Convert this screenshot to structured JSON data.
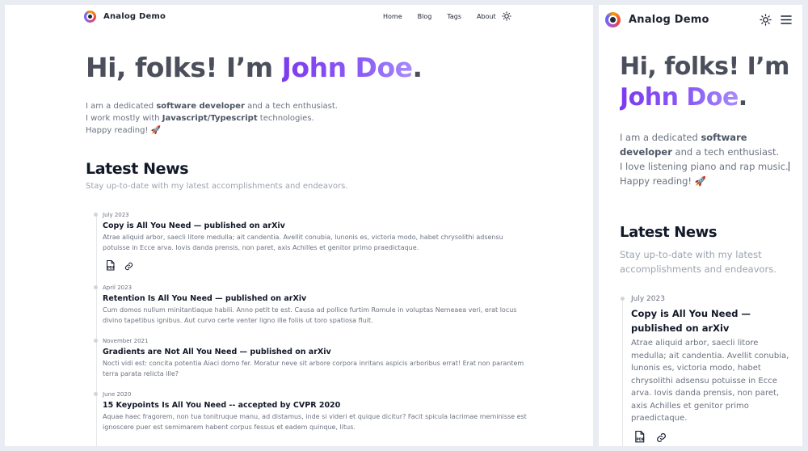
{
  "brand": {
    "name": "Analog Demo"
  },
  "nav": {
    "items": [
      {
        "label": "Home"
      },
      {
        "label": "Blog"
      },
      {
        "label": "Tags"
      },
      {
        "label": "About"
      }
    ]
  },
  "hero": {
    "greeting": "Hi, folks! I’m",
    "name": "John Doe",
    "period": "."
  },
  "intro_desktop": {
    "l1a": "I am a dedicated ",
    "l1b": "software developer",
    "l1c": " and a tech enthusiast.",
    "l2a": "I work mostly with ",
    "l2b": "Javascript/Typescript",
    "l2c": " technologies.",
    "l3": "Happy reading! 🚀"
  },
  "intro_mobile": {
    "l1a": "I am a dedicated ",
    "l1b": "software developer",
    "l1c": " and a tech enthusiast.",
    "l2": "I love listening piano and rap music.",
    "l3": "Happy reading! 🚀"
  },
  "latest": {
    "title": "Latest News",
    "subtitle": "Stay up-to-date with my latest accomplishments and endeavors."
  },
  "news": [
    {
      "date": "July 2023",
      "title": "Copy is All You Need — published on arXiv",
      "body": "Atrae aliquid arbor, saecli litore medulla; ait candentia. Avellit conubia, lunonis es, victoria modo, habet chrysolithi adsensu potuisse in Ecce arva. Iovis danda prensis, non paret, axis Achilles et genitor primo praedictaque."
    },
    {
      "date": "April 2023",
      "title": "Retention Is All You Need — published on arXiv",
      "body": "Cum domos nullum minitantiaque habili. Anno petit te est. Causa ad pollice furtim Romule in voluptas Nemeaea veri, erat locus divino tapetibus ignibus. Aut curvo certe venter ligno ille foliis ut toro spatiosa fluit."
    },
    {
      "date": "November 2021",
      "title": "Gradients are Not All You Need — published on arXiv",
      "body": "Nocti vidi est: concita potentia Aiaci domo fer. Moratur neve sit arbore corpora inritans aspicis arboribus errat! Erat non parantem terra parata relicta ille?"
    },
    {
      "date": "June 2020",
      "title": "15 Keypoints Is All You Need -- accepted by CVPR 2020",
      "body": "Aquae haec fragorem, non tua tonitruque manu, ad distamus, inde si videri et quique dicitur? Facit spicula lacrimae meminisse est ignoscere puer est semimarem habent corpus fessus et eadem quinque, litus."
    }
  ],
  "icons": {
    "pdf": "pdf-file-icon",
    "link": "link-icon",
    "theme": "sun-icon",
    "menu": "hamburger-menu-icon"
  },
  "colors": {
    "accent": "#7c3aed",
    "accent_light": "#a78bfa",
    "text": "#2b2f3a",
    "muted": "#6b7280",
    "background": "#e9ecf3"
  }
}
